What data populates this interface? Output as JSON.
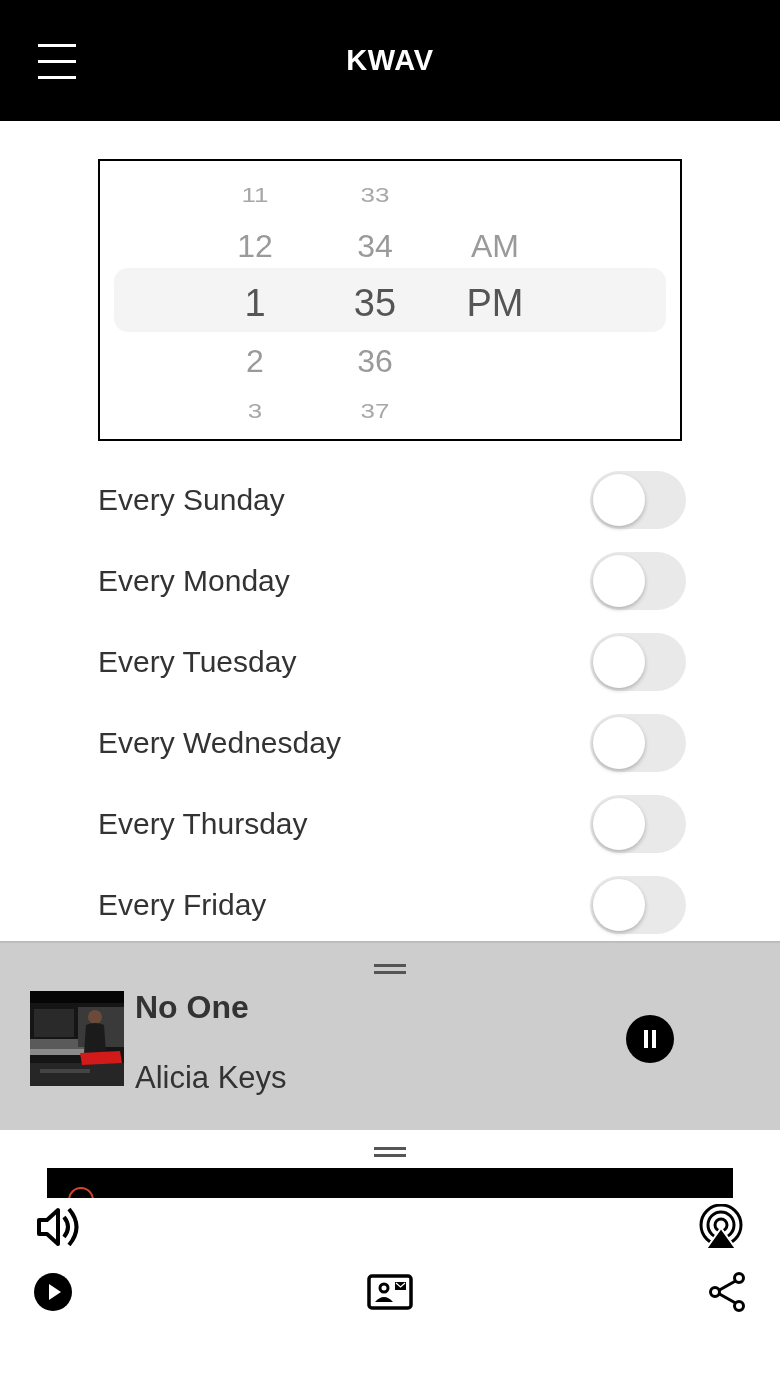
{
  "header": {
    "title": "KWAV"
  },
  "time_picker": {
    "columns": [
      {
        "items": [
          {
            "label": "11",
            "selected": false
          },
          {
            "label": "12",
            "selected": false
          },
          {
            "label": "1",
            "selected": true
          },
          {
            "label": "2",
            "selected": false
          },
          {
            "label": "3",
            "selected": false
          }
        ]
      },
      {
        "items": [
          {
            "label": "33",
            "selected": false
          },
          {
            "label": "34",
            "selected": false
          },
          {
            "label": "35",
            "selected": true
          },
          {
            "label": "36",
            "selected": false
          },
          {
            "label": "37",
            "selected": false
          }
        ]
      },
      {
        "items": [
          {
            "label": "AM",
            "selected": false
          },
          {
            "label": "PM",
            "selected": true
          }
        ]
      }
    ]
  },
  "alarms": [
    {
      "label": "Every Sunday",
      "on": false
    },
    {
      "label": "Every Monday",
      "on": false
    },
    {
      "label": "Every Tuesday",
      "on": false
    },
    {
      "label": "Every Wednesday",
      "on": false
    },
    {
      "label": "Every Thursday",
      "on": false
    },
    {
      "label": "Every Friday",
      "on": false
    }
  ],
  "now_playing": {
    "title": "No One",
    "artist": "Alicia Keys",
    "playing": true
  }
}
